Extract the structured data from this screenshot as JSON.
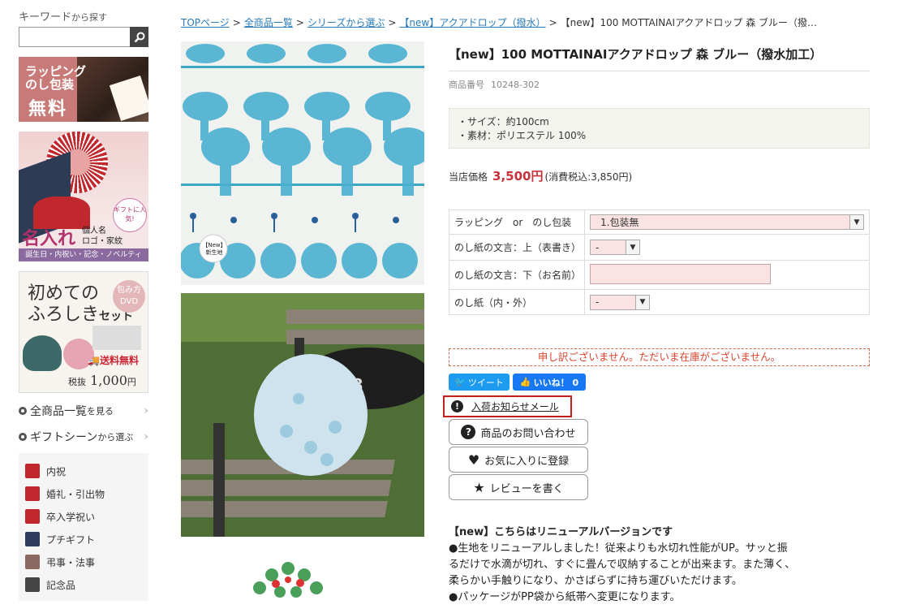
{
  "sidebar": {
    "keyword_label": "キーワード",
    "keyword_suffix": "から探す",
    "search_placeholder": "",
    "banner_wrapping": {
      "line1": "ラッピング",
      "line2": "のし包装",
      "line3": "無料"
    },
    "banner_name": {
      "badge": "ギフトに人気!",
      "big": "名入れ",
      "small1": "個人名",
      "small2": "ロゴ・家紋",
      "footer": "誕生日・内祝い・記念・ノベルティ"
    },
    "banner_furoshiki": {
      "title1": "初めての",
      "title2": "ふろしき",
      "title3": "セット",
      "dvd": "包み方DVD",
      "free": "送料無料",
      "price_label": "税抜",
      "price": "1,000",
      "price_unit": "円"
    },
    "links": [
      {
        "label": "全商品一覧",
        "suffix": "を見る"
      },
      {
        "label": "ギフトシーン",
        "suffix": "から選ぶ"
      }
    ],
    "scenes": [
      {
        "label": "内祝",
        "color": "#c0282d"
      },
      {
        "label": "婚礼・引出物",
        "color": "#c0282d"
      },
      {
        "label": "卒入学祝い",
        "color": "#c0282d"
      },
      {
        "label": "プチギフト",
        "color": "#2f3b5c"
      },
      {
        "label": "弔事・法事",
        "color": "#8a6a60"
      },
      {
        "label": "記念品",
        "color": "#444444"
      }
    ]
  },
  "breadcrumb": {
    "items": [
      "TOPページ",
      "全商品一覧",
      "シリーズから選ぶ",
      "【new】アクアドロップ（撥水）"
    ],
    "current": "【new】100 MOTTAINAIアクアドロップ 森 ブルー（撥…",
    "separator": ">"
  },
  "product": {
    "name": "【new】100 MOTTAINAIアクアドロップ 森 ブルー（撥水加工）",
    "number_label": "商品番号",
    "number": "10248-302",
    "specs": [
      "・サイズ：約100cm",
      "・素材：ポリエステル 100%"
    ],
    "price_label": "当店価格",
    "price": "3,500円",
    "price_tax": "(消費税込:3,850円)",
    "image_badge": "【New】新生地"
  },
  "options": [
    {
      "label": "ラッピング　or　のし包装",
      "type": "select",
      "value": "1.包装無"
    },
    {
      "label": "のし紙の文言：上（表書き）",
      "type": "select",
      "value": "-"
    },
    {
      "label": "のし紙の文言：下（お名前）",
      "type": "text",
      "value": ""
    },
    {
      "label": "のし紙（内・外）",
      "type": "select",
      "value": "-"
    }
  ],
  "stock_message": "申し訳ございません。ただいま在庫がございません。",
  "social": {
    "tweet": "ツイート",
    "like": "いいね！ 0"
  },
  "actions": {
    "notify": "入荷お知らせメール",
    "inquiry": "商品のお問い合わせ",
    "favorite": "お気に入りに登録",
    "review": "レビューを書く"
  },
  "description": {
    "head": "【new】こちらはリニューアルバージョンです",
    "lines": [
      "●生地をリニューアルしました！従来よりも水切れ性能がUP。サッと振",
      "るだけで水滴が切れ、すぐに畳んで収納することが出来ます。また薄く、",
      "柔らかい手触りになり、かさばらずに持ち運びいただけます。",
      "●パッケージがPP袋から紙帯へ変更になります。"
    ]
  },
  "colors": {
    "link": "#2a7ab8",
    "price": "#c8323a",
    "soldout": "#d8442e",
    "notify_border": "#c41e1e",
    "tweet": "#1d9bf0",
    "fb": "#1877f2"
  }
}
